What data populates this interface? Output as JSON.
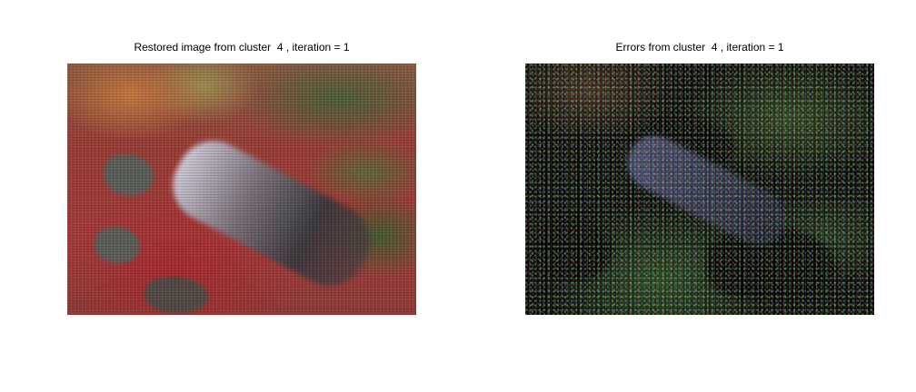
{
  "figure": {
    "left_panel": {
      "title": "Restored image from cluster  4 , iteration = 1"
    },
    "right_panel": {
      "title": "Errors from cluster  4 , iteration = 1"
    }
  }
}
